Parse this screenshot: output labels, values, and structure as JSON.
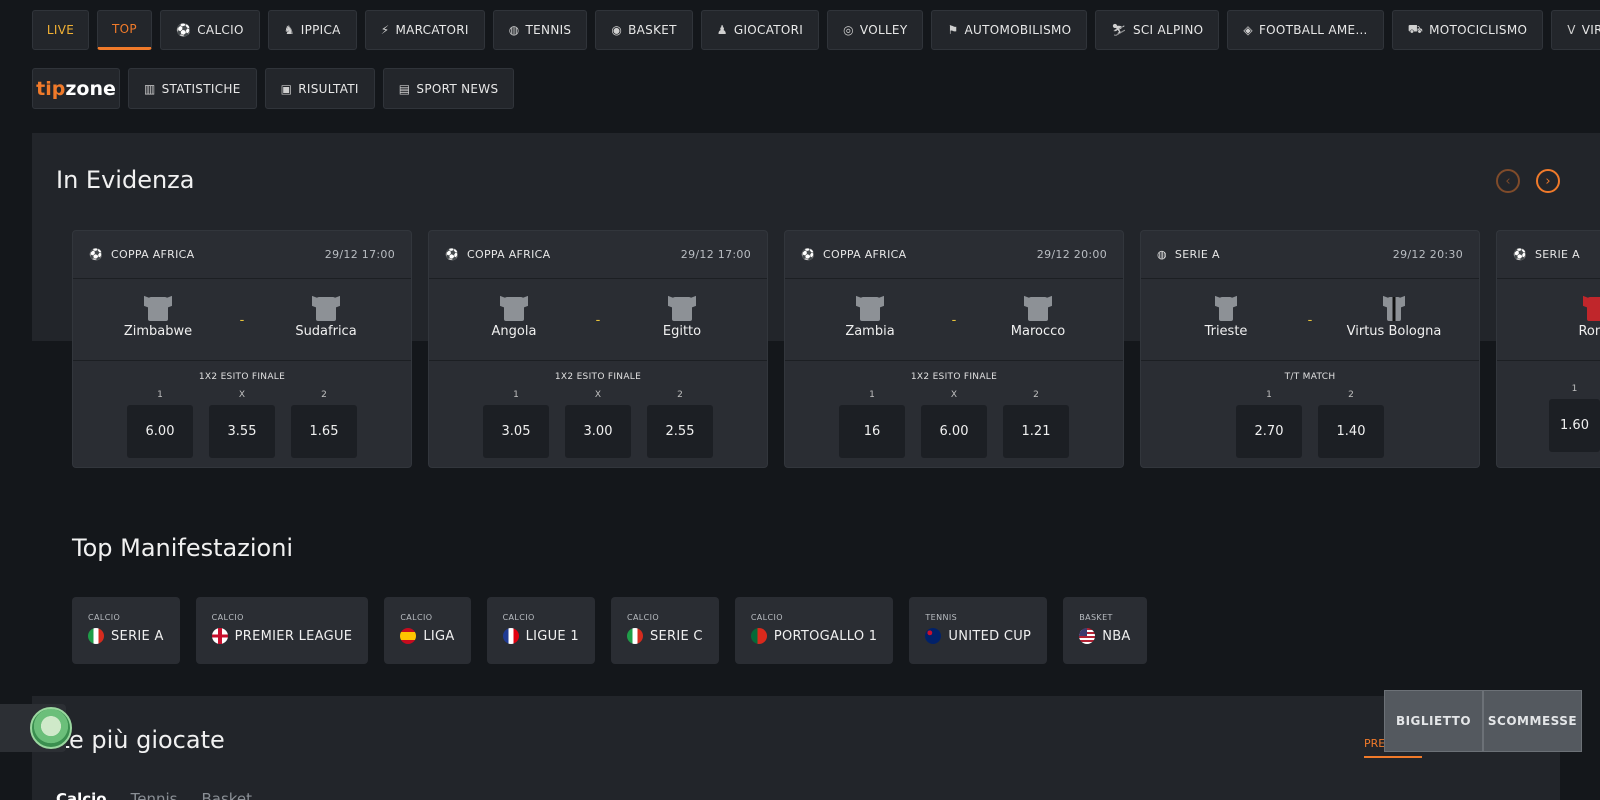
{
  "nav": {
    "items": [
      {
        "label": "LIVE",
        "icon": ""
      },
      {
        "label": "TOP",
        "icon": ""
      },
      {
        "label": "CALCIO",
        "icon": "⚽"
      },
      {
        "label": "IPPICA",
        "icon": "♞"
      },
      {
        "label": "MARCATORI",
        "icon": "⚡"
      },
      {
        "label": "TENNIS",
        "icon": "◍"
      },
      {
        "label": "BASKET",
        "icon": "◉"
      },
      {
        "label": "GIOCATORI",
        "icon": "♟"
      },
      {
        "label": "VOLLEY",
        "icon": "◎"
      },
      {
        "label": "AUTOMOBILISMO",
        "icon": "⚑"
      },
      {
        "label": "SCI ALPINO",
        "icon": "⛷"
      },
      {
        "label": "FOOTBALL AME…",
        "icon": "◈"
      },
      {
        "label": "MOTOCICLISMO",
        "icon": "⛟"
      },
      {
        "label": "VIRTUAL",
        "icon": "V"
      }
    ],
    "active_index": 1
  },
  "subnav": {
    "logo": {
      "tip": "tip",
      "zone": "zone"
    },
    "items": [
      {
        "label": "STATISTICHE",
        "icon": "▥"
      },
      {
        "label": "RISULTATI",
        "icon": "▣"
      },
      {
        "label": "SPORT NEWS",
        "icon": "▤"
      }
    ]
  },
  "evidenza": {
    "title": "In Evidenza",
    "cards": [
      {
        "league": "COPPA AFRICA",
        "time": "29/12 17:00",
        "home": "Zimbabwe",
        "away": "Sudafrica",
        "market": "1X2 ESITO FINALE",
        "odds": [
          {
            "label": "1",
            "value": "6.00"
          },
          {
            "label": "X",
            "value": "3.55"
          },
          {
            "label": "2",
            "value": "1.65"
          }
        ]
      },
      {
        "league": "COPPA AFRICA",
        "time": "29/12 17:00",
        "home": "Angola",
        "away": "Egitto",
        "market": "1X2 ESITO FINALE",
        "odds": [
          {
            "label": "1",
            "value": "3.05"
          },
          {
            "label": "X",
            "value": "3.00"
          },
          {
            "label": "2",
            "value": "2.55"
          }
        ]
      },
      {
        "league": "COPPA AFRICA",
        "time": "29/12 20:00",
        "home": "Zambia",
        "away": "Marocco",
        "market": "1X2 ESITO FINALE",
        "odds": [
          {
            "label": "1",
            "value": "16"
          },
          {
            "label": "X",
            "value": "6.00"
          },
          {
            "label": "2",
            "value": "1.21"
          }
        ]
      },
      {
        "league": "SERIE A",
        "time": "29/12 20:30",
        "home": "Trieste",
        "away": "Virtus Bologna",
        "market": "T/T MATCH",
        "odds": [
          {
            "label": "1",
            "value": "2.70"
          },
          {
            "label": "2",
            "value": "1.40"
          }
        ]
      },
      {
        "league": "SERIE A",
        "time": "",
        "home": "Roma",
        "away": "",
        "market": "",
        "odds": [
          {
            "label": "1",
            "value": "1.60"
          }
        ]
      }
    ]
  },
  "manifestazioni": {
    "title": "Top Manifestazioni",
    "items": [
      {
        "sport": "CALCIO",
        "name": "SERIE A",
        "flag": "it"
      },
      {
        "sport": "CALCIO",
        "name": "PREMIER LEAGUE",
        "flag": "en"
      },
      {
        "sport": "CALCIO",
        "name": "LIGA",
        "flag": "es"
      },
      {
        "sport": "CALCIO",
        "name": "LIGUE 1",
        "flag": "fr"
      },
      {
        "sport": "CALCIO",
        "name": "SERIE C",
        "flag": "it"
      },
      {
        "sport": "CALCIO",
        "name": "PORTOGALLO 1",
        "flag": "pt"
      },
      {
        "sport": "TENNIS",
        "name": "UNITED CUP",
        "flag": "au"
      },
      {
        "sport": "BASKET",
        "name": "NBA",
        "flag": "us"
      }
    ]
  },
  "piu_giocate": {
    "title": "Le più giocate",
    "tab_pre": "PRE",
    "sports": [
      "Calcio",
      "Tennis",
      "Basket"
    ]
  },
  "slip": {
    "ticket": "BIGLIETTO",
    "bets": "SCOMMESSE"
  },
  "colors": {
    "accent": "#f07a2a",
    "live": "#f2b134",
    "bg": "#14171b",
    "card": "#2a2d33"
  }
}
